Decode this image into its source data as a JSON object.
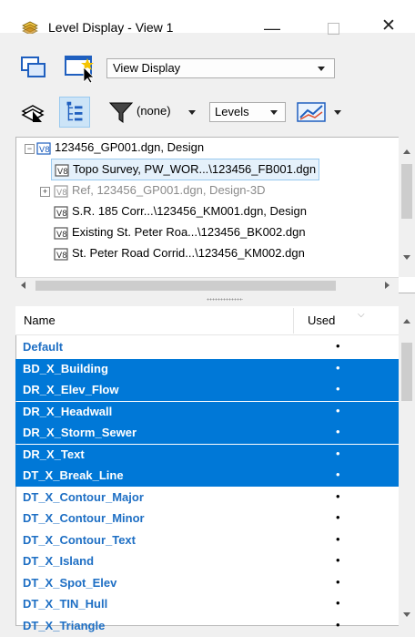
{
  "window": {
    "title": "Level Display - View 1",
    "minimize": "—",
    "close": "✕"
  },
  "toolbar": {
    "view_display_select": "View Display",
    "filter_value": "(none)",
    "levels_select": "Levels"
  },
  "tree": {
    "rows": [
      {
        "label": "123456_GP001.dgn, Design"
      },
      {
        "label": "Topo Survey, PW_WOR...\\123456_FB001.dgn"
      },
      {
        "label": "Ref, 123456_GP001.dgn, Design-3D"
      },
      {
        "label": "S.R. 185 Corr...\\123456_KM001.dgn, Design"
      },
      {
        "label": "Existing St. Peter Roa...\\123456_BK002.dgn"
      },
      {
        "label": "St. Peter Road Corrid...\\123456_KM002.dgn"
      }
    ]
  },
  "list": {
    "header": {
      "name": "Name",
      "used": "Used"
    },
    "rows": [
      {
        "name": "Default",
        "used": "•",
        "selected": false
      },
      {
        "name": "BD_X_Building",
        "used": "•",
        "selected": true
      },
      {
        "name": "DR_X_Elev_Flow",
        "used": "•",
        "selected": true
      },
      {
        "name": "DR_X_Headwall",
        "used": "•",
        "selected": true
      },
      {
        "name": "DR_X_Storm_Sewer",
        "used": "•",
        "selected": true
      },
      {
        "name": "DR_X_Text",
        "used": "•",
        "selected": true
      },
      {
        "name": "DT_X_Break_Line",
        "used": "•",
        "selected": true
      },
      {
        "name": "DT_X_Contour_Major",
        "used": "•",
        "selected": false
      },
      {
        "name": "DT_X_Contour_Minor",
        "used": "•",
        "selected": false
      },
      {
        "name": "DT_X_Contour_Text",
        "used": "•",
        "selected": false
      },
      {
        "name": "DT_X_Island",
        "used": "•",
        "selected": false
      },
      {
        "name": "DT_X_Spot_Elev",
        "used": "•",
        "selected": false
      },
      {
        "name": "DT_X_TIN_Hull",
        "used": "•",
        "selected": false
      },
      {
        "name": "DT_X_Triangle",
        "used": "•",
        "selected": false
      }
    ]
  },
  "colors": {
    "selection": "#0078d7",
    "level_text": "#1e6fc4",
    "tree_selection": "#e5f1fb"
  }
}
